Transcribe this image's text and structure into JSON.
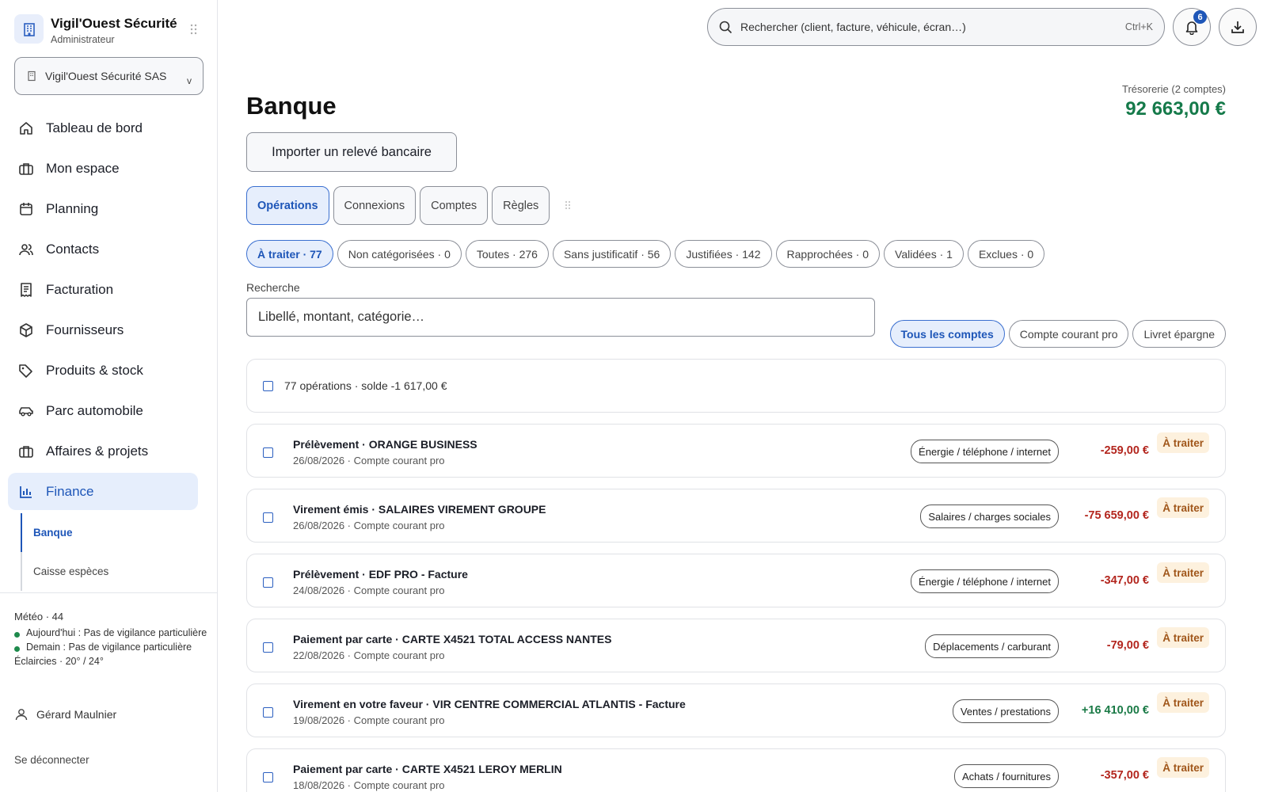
{
  "brand": {
    "name": "Vigil'Ouest Sécurité",
    "role": "Administrateur"
  },
  "company_select": {
    "value": "Vigil'Ouest Sécurité SAS",
    "chevron": "v"
  },
  "nav": {
    "items": [
      {
        "label": "Tableau de bord",
        "icon": "home-icon"
      },
      {
        "label": "Mon espace",
        "icon": "briefcase-icon"
      },
      {
        "label": "Planning",
        "icon": "calendar-icon"
      },
      {
        "label": "Contacts",
        "icon": "users-icon"
      },
      {
        "label": "Facturation",
        "icon": "receipt-icon"
      },
      {
        "label": "Fournisseurs",
        "icon": "box-icon"
      },
      {
        "label": "Produits & stock",
        "icon": "tag-icon"
      },
      {
        "label": "Parc automobile",
        "icon": "car-icon"
      },
      {
        "label": "Affaires & projets",
        "icon": "briefcase-icon"
      },
      {
        "label": "Finance",
        "icon": "bar-chart-icon",
        "active": true
      }
    ],
    "sub": [
      {
        "label": "Banque",
        "active": true
      },
      {
        "label": "Caisse espèces"
      }
    ]
  },
  "weather": {
    "title": "Météo · 44",
    "today": "Aujourd'hui : Pas de vigilance particulière",
    "tomorrow": "Demain : Pas de vigilance particulière",
    "summary": "Éclaircies · 20° / 24°"
  },
  "user": {
    "name": "Gérard Maulnier",
    "logout": "Se déconnecter"
  },
  "topbar": {
    "search_placeholder": "Rechercher (client, facture, véhicule, écran…)",
    "shortcut": "Ctrl+K",
    "notifications_count": "6"
  },
  "page": {
    "title": "Banque",
    "treso_label": "Trésorerie (2 comptes)",
    "treso_value": "92 663,00 €",
    "import_label": "Importer un relevé bancaire"
  },
  "tabs": [
    {
      "label": "Opérations",
      "active": true
    },
    {
      "label": "Connexions"
    },
    {
      "label": "Comptes"
    },
    {
      "label": "Règles"
    }
  ],
  "status_filters": [
    {
      "label": "À traiter · 77",
      "active": true
    },
    {
      "label": "Non catégorisées · 0"
    },
    {
      "label": "Toutes · 276"
    },
    {
      "label": "Sans justificatif · 56"
    },
    {
      "label": "Justifiées · 142"
    },
    {
      "label": "Rapprochées · 0"
    },
    {
      "label": "Validées · 1"
    },
    {
      "label": "Exclues · 0"
    }
  ],
  "search": {
    "label": "Recherche",
    "placeholder": "Libellé, montant, catégorie…"
  },
  "account_filters": [
    {
      "label": "Tous les comptes",
      "active": true
    },
    {
      "label": "Compte courant pro"
    },
    {
      "label": "Livret épargne"
    }
  ],
  "summary": {
    "text": "77 opérations · solde -1 617,00 €"
  },
  "transactions": [
    {
      "label": "Prélèvement · ORANGE BUSINESS",
      "meta": "26/08/2026 · Compte courant pro",
      "category": "Énergie / téléphone / internet",
      "amount": "-259,00 €",
      "sign": "neg",
      "status": "À traiter"
    },
    {
      "label": "Virement émis · SALAIRES VIREMENT GROUPE",
      "meta": "26/08/2026 · Compte courant pro",
      "category": "Salaires / charges sociales",
      "amount": "-75 659,00 €",
      "sign": "neg",
      "status": "À traiter"
    },
    {
      "label": "Prélèvement · EDF PRO - Facture",
      "meta": "24/08/2026 · Compte courant pro",
      "category": "Énergie / téléphone / internet",
      "amount": "-347,00 €",
      "sign": "neg",
      "status": "À traiter"
    },
    {
      "label": "Paiement par carte · CARTE X4521 TOTAL ACCESS NANTES",
      "meta": "22/08/2026 · Compte courant pro",
      "category": "Déplacements / carburant",
      "amount": "-79,00 €",
      "sign": "neg",
      "status": "À traiter"
    },
    {
      "label": "Virement en votre faveur · VIR CENTRE COMMERCIAL ATLANTIS - Facture",
      "meta": "19/08/2026 · Compte courant pro",
      "category": "Ventes / prestations",
      "amount": "+16 410,00 €",
      "sign": "pos",
      "status": "À traiter"
    },
    {
      "label": "Paiement par carte · CARTE X4521 LEROY MERLIN",
      "meta": "18/08/2026 · Compte courant pro",
      "category": "Achats / fournitures",
      "amount": "-357,00 €",
      "sign": "neg",
      "status": "À traiter"
    }
  ]
}
